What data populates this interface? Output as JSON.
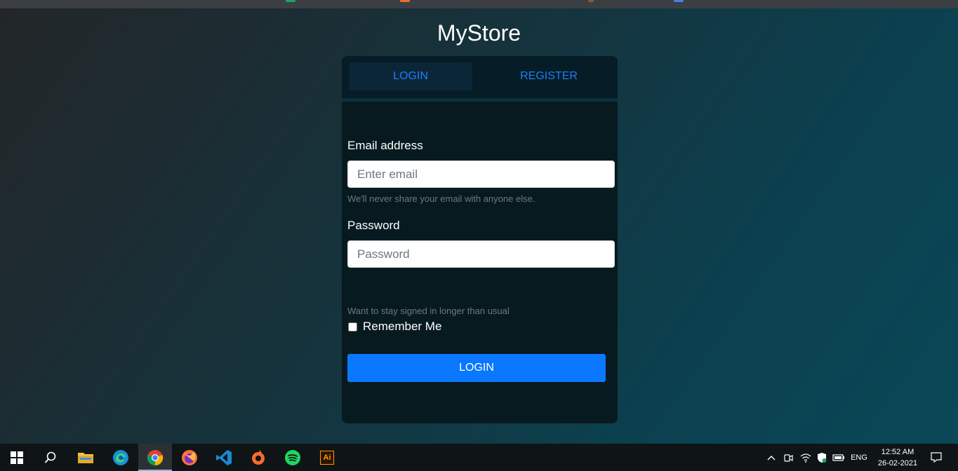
{
  "brand": "MyStore",
  "tabs": {
    "login": "LOGIN",
    "register": "REGISTER"
  },
  "form": {
    "email_label": "Email address",
    "email_placeholder": "Enter email",
    "email_help": "We'll never share your email with anyone else.",
    "password_label": "Password",
    "password_placeholder": "Password",
    "stay_signed_text": "Want to stay signed in longer than usual",
    "remember_label": "Remember Me",
    "remember_checked": false,
    "submit_label": "LOGIN"
  },
  "colors": {
    "accent": "#0a78fe",
    "tab_text": "#1e7ef8",
    "card_bg": "#071a20"
  },
  "taskbar": {
    "apps": [
      "windows-start-icon",
      "search-icon",
      "file-explorer-icon",
      "edge-icon",
      "chrome-icon",
      "firefox-icon",
      "vscode-icon",
      "origin-icon",
      "spotify-icon",
      "illustrator-icon"
    ],
    "active_app": "chrome-icon",
    "illustrator_label": "Ai",
    "language": "ENG",
    "time": "12:52 AM",
    "date": "26-02-2021"
  }
}
